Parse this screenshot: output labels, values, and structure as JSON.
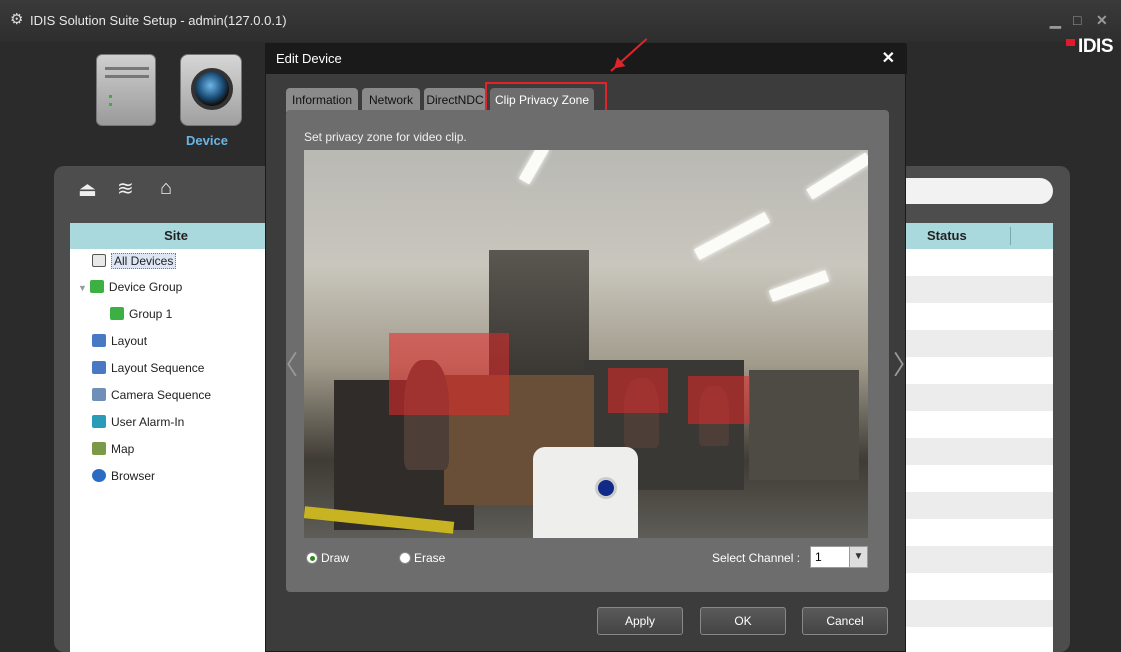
{
  "window": {
    "title": "IDIS Solution Suite Setup - admin(127.0.0.1)",
    "brand": "IDIS",
    "controls": [
      "minimize-icon",
      "maximize-icon",
      "close-icon"
    ]
  },
  "top_nav": {
    "active_label": "Device",
    "icons": [
      "server-icon",
      "camera-device-icon"
    ]
  },
  "toolbar": {
    "icons": [
      "register-upload-icon",
      "network-scan-icon",
      "eject-icon"
    ]
  },
  "site_tree": {
    "header": "Site",
    "items": [
      {
        "label": "All Devices",
        "icon": "all-devices-icon",
        "selected": true
      },
      {
        "label": "Device Group",
        "icon": "device-group-icon",
        "expanded": true
      },
      {
        "label": "Group 1",
        "icon": "group-icon"
      },
      {
        "label": "Layout",
        "icon": "layout-icon"
      },
      {
        "label": "Layout Sequence",
        "icon": "layout-sequence-icon"
      },
      {
        "label": "Camera Sequence",
        "icon": "camera-sequence-icon"
      },
      {
        "label": "User Alarm-In",
        "icon": "user-alarm-in-icon"
      },
      {
        "label": "Map",
        "icon": "map-icon"
      },
      {
        "label": "Browser",
        "icon": "browser-icon"
      }
    ]
  },
  "device_list": {
    "status_header": "Status"
  },
  "dialog": {
    "title": "Edit Device",
    "tabs": [
      {
        "label": "Information"
      },
      {
        "label": "Network"
      },
      {
        "label": "DirectNDC"
      },
      {
        "label": "Clip Privacy Zone",
        "active": true
      }
    ],
    "hint": "Set privacy zone for video clip.",
    "mode_options": [
      {
        "label": "Draw",
        "selected": true
      },
      {
        "label": "Erase",
        "selected": false
      }
    ],
    "channel_label": "Select Channel :",
    "channel_value": "1",
    "buttons": {
      "apply": "Apply",
      "ok": "OK",
      "cancel": "Cancel"
    },
    "highlight_color": "#e0242a"
  }
}
